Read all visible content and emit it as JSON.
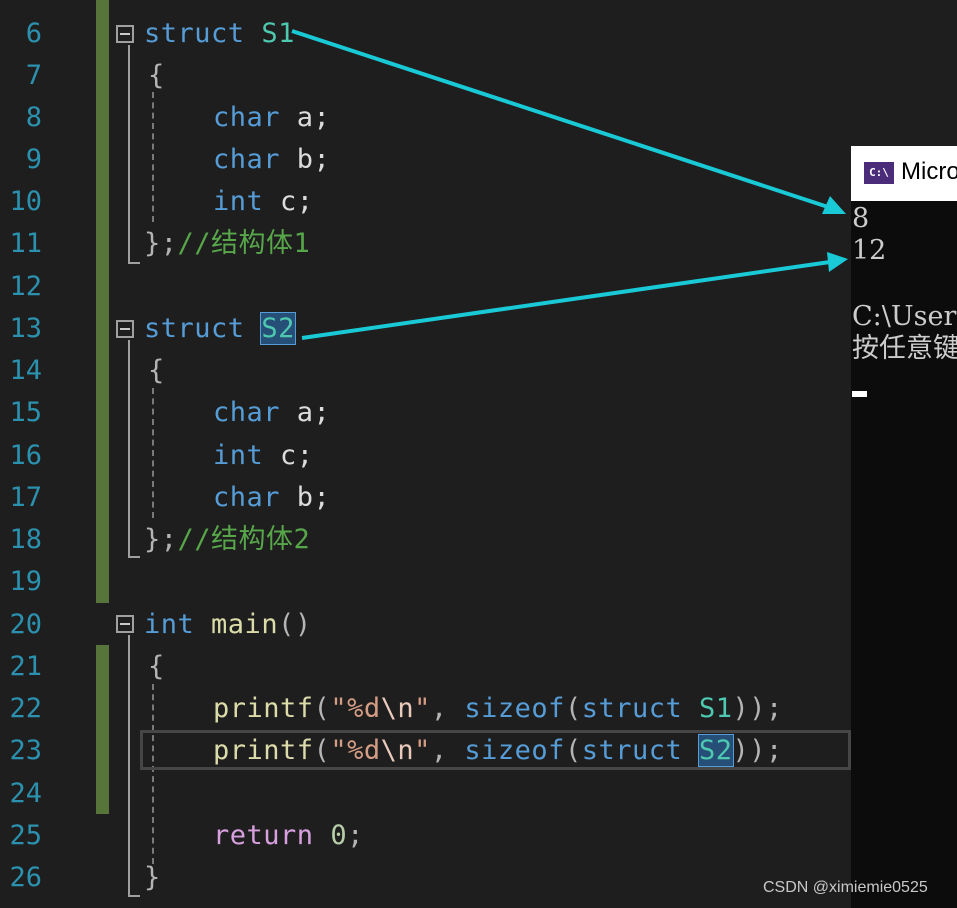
{
  "editor": {
    "line_numbers": [
      "6",
      "7",
      "8",
      "9",
      "10",
      "11",
      "12",
      "13",
      "14",
      "15",
      "16",
      "17",
      "18",
      "19",
      "20",
      "21",
      "22",
      "23",
      "24",
      "25",
      "26"
    ],
    "lines": {
      "l6": [
        "struct",
        " ",
        "S1"
      ],
      "l7": [
        "{"
      ],
      "l8": [
        "char",
        " a;"
      ],
      "l9": [
        "char",
        " b;"
      ],
      "l10": [
        "int",
        " c;"
      ],
      "l11": [
        "};",
        "//结构体1"
      ],
      "l13": [
        "struct",
        " ",
        "S2"
      ],
      "l14": [
        "{"
      ],
      "l15": [
        "char",
        " a;"
      ],
      "l16": [
        "int",
        " c;"
      ],
      "l17": [
        "char",
        " b;"
      ],
      "l18": [
        "};",
        "//结构体2"
      ],
      "l20": [
        "int",
        " ",
        "main",
        "()"
      ],
      "l21": [
        "{"
      ],
      "l22": [
        "printf",
        "(",
        "\"%d",
        "\\n",
        "\"",
        ", ",
        "sizeof",
        "(",
        "struct",
        " ",
        "S1",
        "));"
      ],
      "l23": [
        "printf",
        "(",
        "\"%d",
        "\\n",
        "\"",
        ", ",
        "sizeof",
        "(",
        "struct",
        " ",
        "S2",
        "));"
      ],
      "l25": [
        "return",
        " ",
        "0",
        ";"
      ],
      "l26": [
        "}"
      ]
    }
  },
  "console": {
    "title": "Micro",
    "icon_text": "C:\\",
    "output": [
      "8",
      "12",
      "",
      "C:\\User",
      "按任意键"
    ]
  },
  "watermark": "CSDN @ximiemie0525",
  "colors": {
    "background": "#1e1e1e",
    "keyword": "#569cd6",
    "type_name": "#4ec9b0",
    "function": "#dcdcaa",
    "string": "#d69d85",
    "comment": "#57a64a",
    "return_keyword": "#d8a0df",
    "line_number": "#2b91af",
    "arrow": "#19c9d6",
    "change_bar": "#57743a"
  },
  "icons": [
    "fold-collapse-icon",
    "console-app-icon",
    "annotation-arrow"
  ]
}
